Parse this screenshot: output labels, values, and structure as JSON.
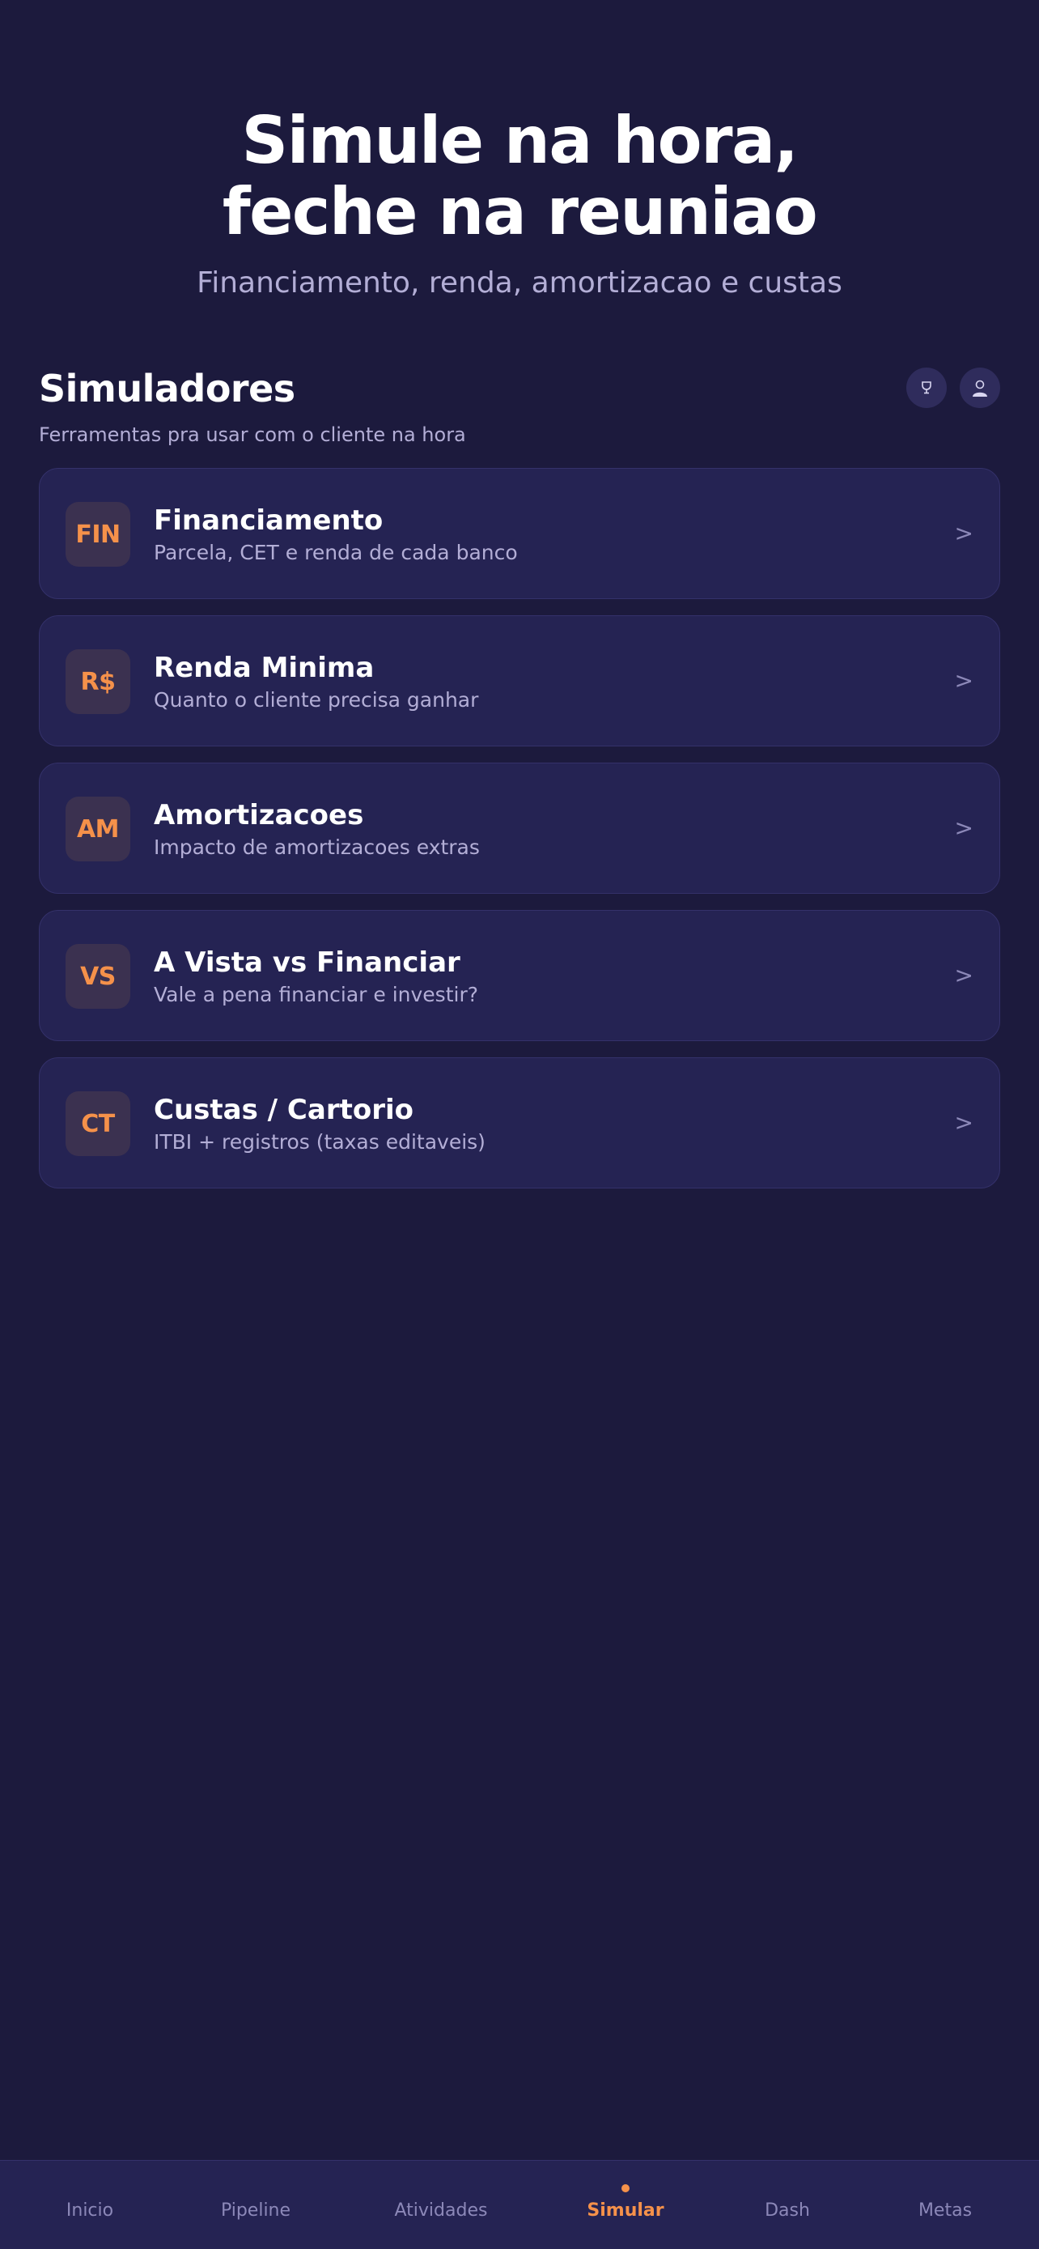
{
  "hero": {
    "title_line1": "Simule na hora,",
    "title_line2": "feche na reuniao",
    "subtitle": "Financiamento, renda, amortizacao e custas"
  },
  "section": {
    "title": "Simuladores",
    "subtitle": "Ferramentas pra usar com o cliente na hora",
    "icons": [
      "trophy-icon",
      "user-icon"
    ]
  },
  "simulators": [
    {
      "badge": "FIN",
      "title": "Financiamento",
      "description": "Parcela, CET e renda de cada banco",
      "arrow": ">"
    },
    {
      "badge": "R$",
      "title": "Renda Minima",
      "description": "Quanto o cliente precisa ganhar",
      "arrow": ">"
    },
    {
      "badge": "AM",
      "title": "Amortizacoes",
      "description": "Impacto de amortizacoes extras",
      "arrow": ">"
    },
    {
      "badge": "VS",
      "title": "A Vista vs Financiar",
      "description": "Vale a pena financiar e investir?",
      "arrow": ">"
    },
    {
      "badge": "CT",
      "title": "Custas / Cartorio",
      "description": "ITBI + registros (taxas editaveis)",
      "arrow": ">"
    }
  ],
  "nav": {
    "items": [
      "Inicio",
      "Pipeline",
      "Atividades",
      "Simular",
      "Dash",
      "Metas"
    ],
    "active": "Simular"
  },
  "colors": {
    "background": "#1c1a3d",
    "card": "#252353",
    "accent": "#f5914a",
    "muted_text": "#b3aed6"
  }
}
